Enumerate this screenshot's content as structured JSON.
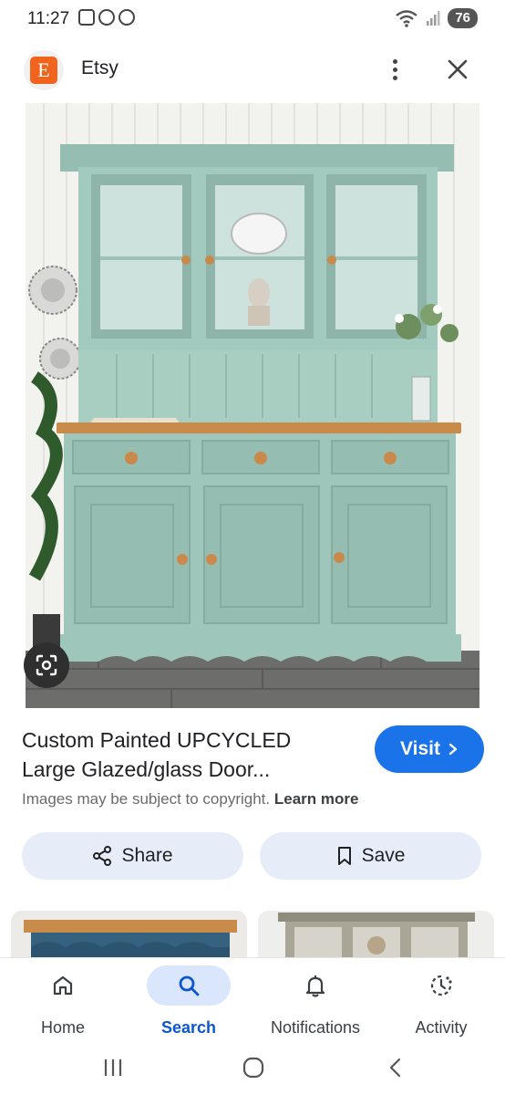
{
  "status_bar": {
    "time": "11:27",
    "battery": "76"
  },
  "source": {
    "name": "Etsy",
    "logo_letter": "E",
    "logo_color": "#f1641e"
  },
  "result": {
    "title_line1": "Custom Painted UPCYCLED",
    "title_line2": "Large Glazed/glass Door...",
    "visit_label": "Visit",
    "copyright_text": "Images may be subject to copyright.",
    "learn_more": "Learn more"
  },
  "actions": {
    "share_label": "Share",
    "save_label": "Save"
  },
  "nav": {
    "items": [
      {
        "label": "Home",
        "icon": "home-icon",
        "active": false
      },
      {
        "label": "Search",
        "icon": "search-icon",
        "active": true
      },
      {
        "label": "Notifications",
        "icon": "bell-icon",
        "active": false
      },
      {
        "label": "Activity",
        "icon": "activity-icon",
        "active": false
      }
    ]
  },
  "colors": {
    "accent": "#1a73e8",
    "active_nav": "#0b57d0",
    "chip_bg": "#e6edf8",
    "dresser_green": "#9dc4b8"
  }
}
